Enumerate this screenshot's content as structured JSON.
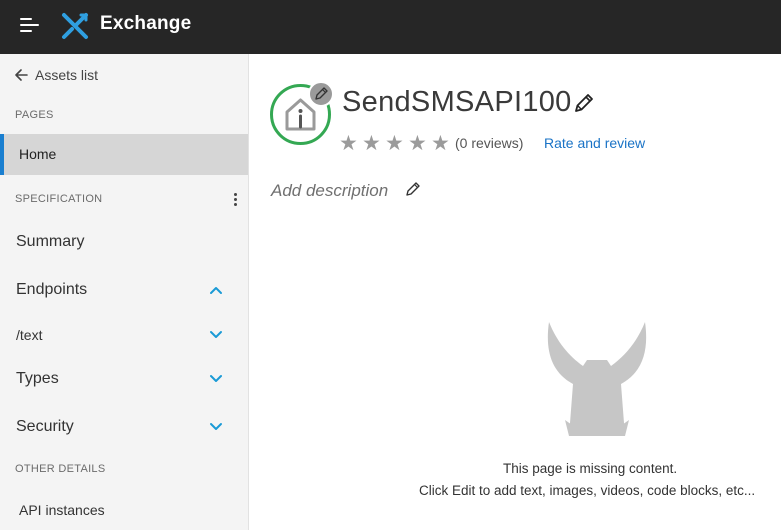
{
  "header": {
    "app_title": "Exchange",
    "menu_icon": "hamburger-menu-icon",
    "logo_icon": "exchange-logo-icon",
    "background_color": "#262626"
  },
  "sidebar": {
    "back_link": "Assets list",
    "pages_label": "PAGES",
    "home": "Home",
    "specification_label": "SPECIFICATION",
    "items": [
      {
        "label": "Summary",
        "chevron": null
      },
      {
        "label": "Endpoints",
        "chevron": "up"
      },
      {
        "label": "/text",
        "chevron": "down"
      },
      {
        "label": "Types",
        "chevron": "down"
      },
      {
        "label": "Security",
        "chevron": "down"
      }
    ],
    "other_details_label": "OTHER DETAILS",
    "api_instances": "API instances",
    "accent_color": "#1a7fd0",
    "chevron_color": "#1a9ad6"
  },
  "asset": {
    "title": "SendSMSAPI100",
    "rating_stars": 5,
    "rating_value": 0,
    "reviews": "(0 reviews)",
    "rate_link": "Rate and review",
    "description_placeholder": "Add description",
    "icon_ring_color": "#34a853",
    "link_color": "#1a73c6"
  },
  "empty_state": {
    "line1": "This page is missing content.",
    "line2": "Click Edit to add text, images, videos, code blocks, etc..."
  }
}
